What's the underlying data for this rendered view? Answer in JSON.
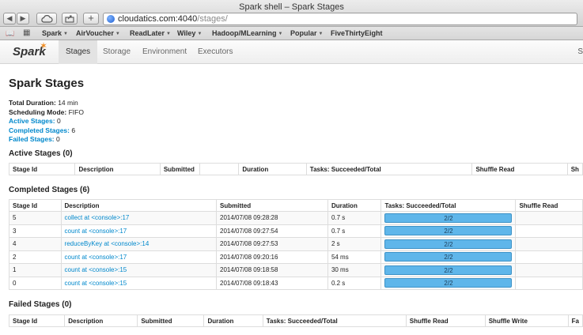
{
  "window": {
    "title": "Spark shell – Spark Stages"
  },
  "url": {
    "host": "cloudatics.com:4040",
    "path": "/stages/"
  },
  "bookmarks": [
    {
      "label": "Spark",
      "menu": true
    },
    {
      "label": "AirVoucher",
      "menu": true
    },
    {
      "label": "ReadLater",
      "menu": true
    },
    {
      "label": "Wiley",
      "menu": true
    },
    {
      "label": "Hadoop/MLearning",
      "menu": true
    },
    {
      "label": "Popular",
      "menu": true
    },
    {
      "label": "FiveThirtyEight",
      "menu": false
    }
  ],
  "nav": {
    "logo": "Spark",
    "tabs": [
      "Stages",
      "Storage",
      "Environment",
      "Executors"
    ],
    "trunc": "S"
  },
  "page": {
    "title": "Spark Stages",
    "summary": {
      "total_duration_label": "Total Duration:",
      "total_duration": "14 min",
      "scheduling_label": "Scheduling Mode:",
      "scheduling": "FIFO",
      "active_label": "Active Stages:",
      "active": "0",
      "completed_label": "Completed Stages:",
      "completed": "6",
      "failed_label": "Failed Stages:",
      "failed": "0"
    }
  },
  "active": {
    "heading": "Active Stages (0)",
    "columns": [
      "Stage Id",
      "Description",
      "Submitted",
      "",
      "Duration",
      "Tasks: Succeeded/Total",
      "Shuffle Read",
      "Sh"
    ]
  },
  "completed": {
    "heading": "Completed Stages (6)",
    "columns": [
      "Stage Id",
      "Description",
      "Submitted",
      "Duration",
      "Tasks: Succeeded/Total",
      "Shuffle Read"
    ],
    "rows": [
      {
        "id": "5",
        "desc": "collect at <console>:17",
        "submitted": "2014/07/08 09:28:28",
        "duration": "0.7 s",
        "tasks": "2/2",
        "fraction": 1
      },
      {
        "id": "3",
        "desc": "count at <console>:17",
        "submitted": "2014/07/08 09:27:54",
        "duration": "0.7 s",
        "tasks": "2/2",
        "fraction": 1
      },
      {
        "id": "4",
        "desc": "reduceByKey at <console>:14",
        "submitted": "2014/07/08 09:27:53",
        "duration": "2 s",
        "tasks": "2/2",
        "fraction": 1
      },
      {
        "id": "2",
        "desc": "count at <console>:17",
        "submitted": "2014/07/08 09:20:16",
        "duration": "54 ms",
        "tasks": "2/2",
        "fraction": 1
      },
      {
        "id": "1",
        "desc": "count at <console>:15",
        "submitted": "2014/07/08 09:18:58",
        "duration": "30 ms",
        "tasks": "2/2",
        "fraction": 1
      },
      {
        "id": "0",
        "desc": "count at <console>:15",
        "submitted": "2014/07/08 09:18:43",
        "duration": "0.2 s",
        "tasks": "2/2",
        "fraction": 1
      }
    ]
  },
  "failed": {
    "heading": "Failed Stages (0)",
    "columns": [
      "Stage Id",
      "Description",
      "Submitted",
      "Duration",
      "Tasks: Succeeded/Total",
      "Shuffle Read",
      "Shuffle Write",
      "Fa"
    ]
  }
}
